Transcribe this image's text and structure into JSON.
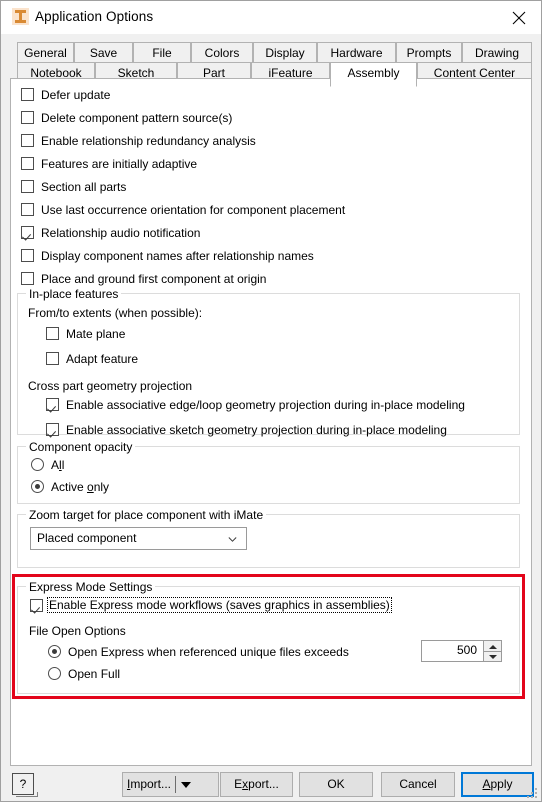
{
  "window": {
    "title": "Application Options",
    "icon": "inventor-logo-icon",
    "close_label": "✕"
  },
  "tabs": {
    "row1": [
      {
        "label": "General",
        "active": false
      },
      {
        "label": "Save",
        "active": false
      },
      {
        "label": "File",
        "active": false
      },
      {
        "label": "Colors",
        "active": false
      },
      {
        "label": "Display",
        "active": false
      },
      {
        "label": "Hardware",
        "active": false
      },
      {
        "label": "Prompts",
        "active": false
      },
      {
        "label": "Drawing",
        "active": false
      }
    ],
    "row2": [
      {
        "label": "Notebook",
        "active": false
      },
      {
        "label": "Sketch",
        "active": false
      },
      {
        "label": "Part",
        "active": false
      },
      {
        "label": "iFeature",
        "active": false
      },
      {
        "label": "Assembly",
        "active": true
      },
      {
        "label": "Content Center",
        "active": false
      }
    ]
  },
  "options": {
    "checkboxes": [
      {
        "label": "Defer update",
        "checked": false
      },
      {
        "label": "Delete component pattern source(s)",
        "checked": false
      },
      {
        "label": "Enable relationship redundancy analysis",
        "checked": false
      },
      {
        "label": "Features are initially adaptive",
        "checked": false
      },
      {
        "label": "Section all parts",
        "checked": false
      },
      {
        "label": "Use last occurrence orientation for component placement",
        "checked": false
      },
      {
        "label": "Relationship audio notification",
        "checked": true
      },
      {
        "label": "Display component names after relationship names",
        "checked": false
      },
      {
        "label": "Place and ground first component at origin",
        "checked": false
      }
    ]
  },
  "inplace": {
    "group_title": "In-place features",
    "extents_label": "From/to extents (when possible):",
    "extents_options": [
      {
        "label": "Mate plane",
        "checked": false
      },
      {
        "label": "Adapt feature",
        "checked": false
      }
    ],
    "projection_label": "Cross part geometry projection",
    "projection_options": [
      {
        "label": "Enable associative edge/loop geometry projection during in-place modeling",
        "checked": true
      },
      {
        "label": "Enable associative sketch geometry projection during in-place modeling",
        "checked": true
      }
    ]
  },
  "opacity": {
    "group_title": "Component opacity",
    "options": [
      {
        "label_pre": "A",
        "label_accel": "l",
        "label_post": "l",
        "selected": false
      },
      {
        "label_pre": "Active ",
        "label_accel": "o",
        "label_post": "nly",
        "selected": true
      }
    ]
  },
  "zoom_target": {
    "group_title": "Zoom target for place component with iMate",
    "value": "Placed component",
    "arrow": "chevron-down-icon"
  },
  "express": {
    "group_title": "Express Mode Settings",
    "enable_checkbox": {
      "label": "Enable Express mode workflows (saves graphics in assemblies)",
      "checked": true,
      "focused": true
    },
    "file_open_label": "File Open Options",
    "radios": [
      {
        "label": "Open Express when referenced unique files exceeds",
        "selected": true
      },
      {
        "label": "Open Full",
        "selected": false
      }
    ],
    "spinner_value": "500",
    "highlight_color": "#e3051b"
  },
  "footer": {
    "help_label": "?",
    "buttons": [
      {
        "name": "import",
        "pre": "",
        "accel": "I",
        "post": "mport...",
        "split": true,
        "focus": false
      },
      {
        "name": "export",
        "pre": "E",
        "accel": "x",
        "post": "port...",
        "split": false,
        "focus": false
      },
      {
        "name": "ok",
        "pre": "OK",
        "accel": "",
        "post": "",
        "split": false,
        "focus": false
      },
      {
        "name": "cancel",
        "pre": "Cancel",
        "accel": "",
        "post": "",
        "split": false,
        "focus": false
      },
      {
        "name": "apply",
        "pre": "",
        "accel": "A",
        "post": "pply",
        "split": false,
        "focus": true
      }
    ]
  }
}
